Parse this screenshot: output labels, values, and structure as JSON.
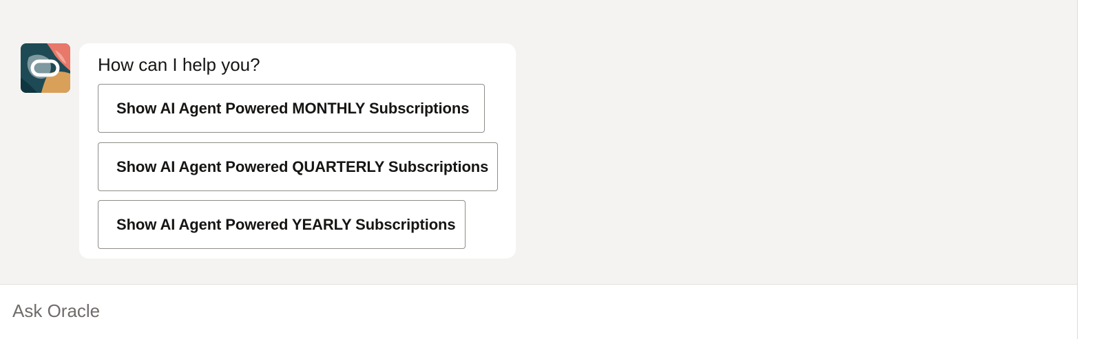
{
  "bot": {
    "avatar_icon": "oracle-logo-icon",
    "greeting": "How can I help you?"
  },
  "actions": [
    {
      "label": "Show AI Agent Powered MONTHLY Subscriptions"
    },
    {
      "label": "Show AI Agent Powered QUARTERLY Subscriptions"
    },
    {
      "label": "Show AI Agent Powered YEARLY Subscriptions"
    }
  ],
  "composer": {
    "placeholder": "Ask Oracle"
  },
  "colors": {
    "chat_background": "#f4f3f1",
    "bubble_background": "#ffffff",
    "button_border": "#8f8c88",
    "text": "#161513"
  }
}
